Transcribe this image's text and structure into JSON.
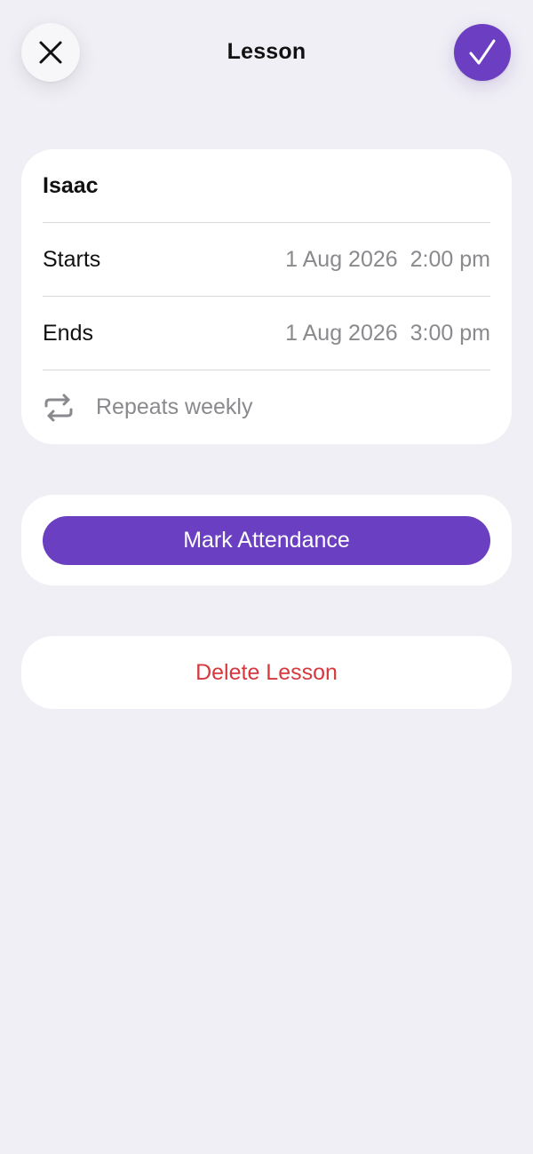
{
  "header": {
    "title": "Lesson",
    "close_icon": "close-icon",
    "confirm_icon": "checkmark-icon"
  },
  "lesson": {
    "student_name": "Isaac",
    "starts": {
      "label": "Starts",
      "date": "1 Aug 2026",
      "time": "2:00 pm"
    },
    "ends": {
      "label": "Ends",
      "date": "1 Aug 2026",
      "time": "3:00 pm"
    },
    "repeat": {
      "icon": "repeat-icon",
      "label": "Repeats weekly"
    }
  },
  "actions": {
    "mark_attendance": "Mark Attendance",
    "delete_lesson": "Delete Lesson"
  },
  "colors": {
    "background": "#f0eff5",
    "accent": "#6a3fc1",
    "destructive": "#d6393d",
    "secondary_text": "#8a8a8e"
  }
}
